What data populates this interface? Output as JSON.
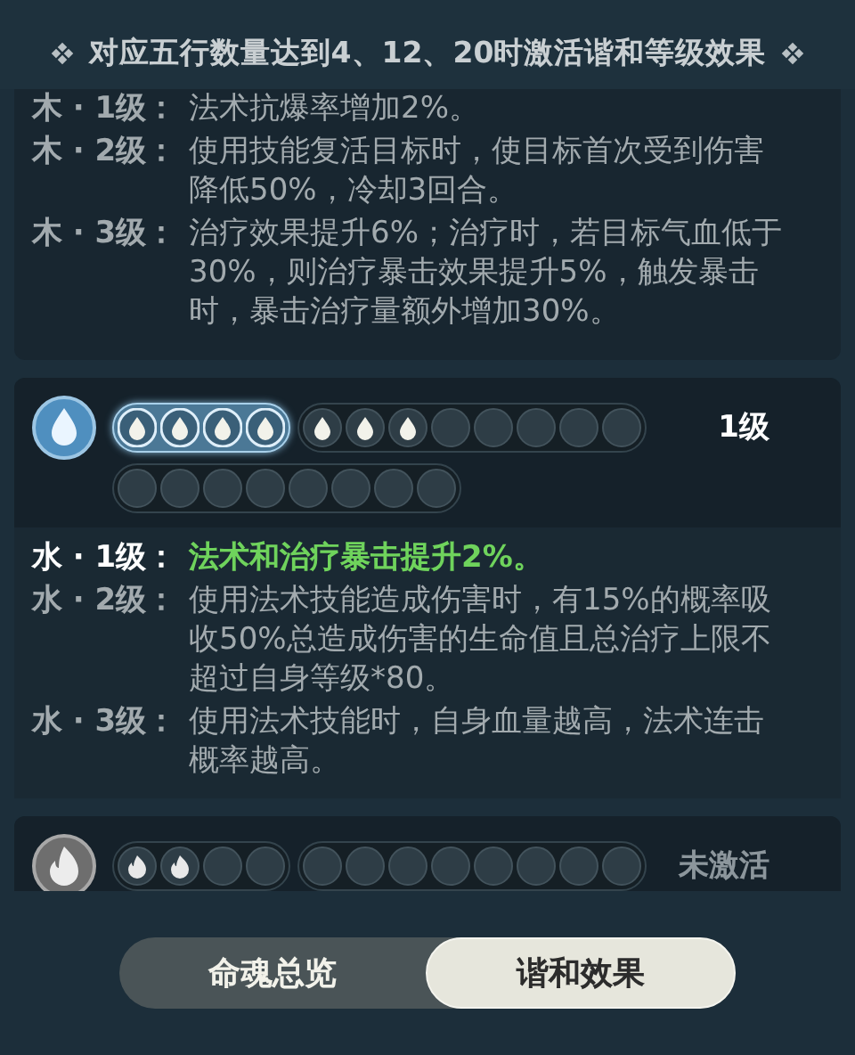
{
  "header": {
    "title": "对应五行数量达到4、12、20时激活谐和等级效果"
  },
  "cards": [
    {
      "effects": [
        {
          "label": "木 · 1级：",
          "text": "法术抗爆率增加2%。",
          "active": false
        },
        {
          "label": "木 · 2级：",
          "text": "使用技能复活目标时，使目标首次受到伤害降低50%，冷却3回合。",
          "active": false
        },
        {
          "label": "木 · 3级：",
          "text": "治疗效果提升6%；治疗时，若目标气血低于30%，则治疗暴击效果提升5%，触发暴击时，暴击治疗量额外增加30%。",
          "active": false
        }
      ]
    },
    {
      "kind": "water",
      "status": "1级",
      "active": true,
      "slot_rows": [
        [
          {
            "active": true,
            "slots": [
              {
                "filled": true
              },
              {
                "filled": true
              },
              {
                "filled": true
              },
              {
                "filled": true
              }
            ]
          },
          {
            "active": false,
            "slots": [
              {
                "filled": true
              },
              {
                "filled": true
              },
              {
                "filled": true
              },
              {
                "filled": false
              },
              {
                "filled": false
              },
              {
                "filled": false
              },
              {
                "filled": false
              },
              {
                "filled": false
              }
            ]
          }
        ],
        [
          {
            "active": false,
            "slots": [
              {
                "filled": false
              },
              {
                "filled": false
              },
              {
                "filled": false
              },
              {
                "filled": false
              },
              {
                "filled": false
              },
              {
                "filled": false
              },
              {
                "filled": false
              },
              {
                "filled": false
              }
            ]
          }
        ]
      ],
      "effects": [
        {
          "label": "水 · 1级：",
          "text": "法术和治疗暴击提升2%。",
          "active": true
        },
        {
          "label": "水 · 2级：",
          "text": "使用法术技能造成伤害时，有15%的概率吸收50%总造成伤害的生命值且总治疗上限不超过自身等级*80。",
          "active": false
        },
        {
          "label": "水 · 3级：",
          "text": "使用法术技能时，自身血量越高，法术连击概率越高。",
          "active": false
        }
      ]
    },
    {
      "kind": "fire",
      "status": "未激活",
      "active": false,
      "slot_rows": [
        [
          {
            "active": false,
            "slots": [
              {
                "filled": true
              },
              {
                "filled": true
              },
              {
                "filled": false
              },
              {
                "filled": false
              }
            ]
          },
          {
            "active": false,
            "slots": [
              {
                "filled": false
              },
              {
                "filled": false
              },
              {
                "filled": false
              },
              {
                "filled": false
              },
              {
                "filled": false
              },
              {
                "filled": false
              },
              {
                "filled": false
              },
              {
                "filled": false
              }
            ]
          }
        ]
      ]
    }
  ],
  "tabs": [
    {
      "label": "命魂总览",
      "selected": false
    },
    {
      "label": "谐和效果",
      "selected": true
    }
  ]
}
